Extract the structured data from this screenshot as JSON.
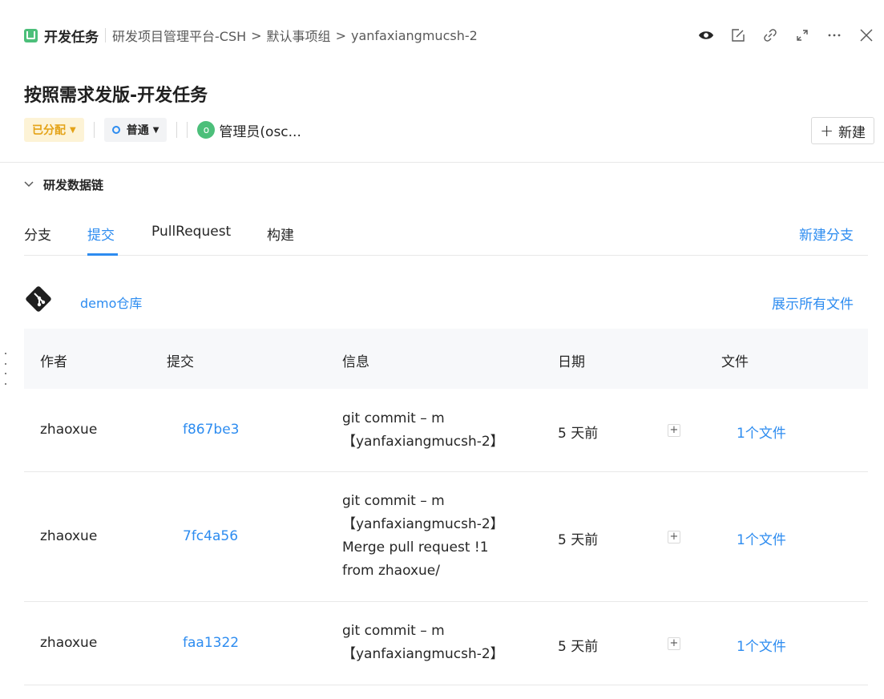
{
  "header": {
    "task_type": "开发任务",
    "breadcrumb": [
      "研发项目管理平台-CSH",
      "默认事项组",
      "yanfaxiangmucsh-2"
    ],
    "breadcrumb_sep": ">"
  },
  "task": {
    "title": "按照需求发版-开发任务",
    "status": "已分配",
    "priority": "普通",
    "assignee_initial": "o",
    "assignee": "管理员(osc...",
    "new_button": "新建"
  },
  "section": {
    "title": "研发数据链",
    "tabs": [
      "分支",
      "提交",
      "PullRequest",
      "构建"
    ],
    "active_tab": "提交",
    "tab_action": "新建分支"
  },
  "repo": {
    "name": "demo仓库",
    "show_all": "展示所有文件"
  },
  "table": {
    "headers": [
      "作者",
      "提交",
      "信息",
      "日期",
      "文件"
    ],
    "rows": [
      {
        "author": "zhaoxue",
        "commit": "f867be3",
        "message": [
          "git commit – m",
          "【yanfaxiangmucsh-2】"
        ],
        "date": "5 天前",
        "files": "1个文件"
      },
      {
        "author": "zhaoxue",
        "commit": "7fc4a56",
        "message": [
          "git commit – m",
          "【yanfaxiangmucsh-2】",
          "Merge pull request !1",
          "from zhaoxue/"
        ],
        "date": "5 天前",
        "files": "1个文件"
      },
      {
        "author": "zhaoxue",
        "commit": "faa1322",
        "message": [
          "git commit – m",
          "【yanfaxiangmucsh-2】"
        ],
        "date": "5 天前",
        "files": "1个文件"
      }
    ]
  },
  "icons": {
    "task_type": "task-icon",
    "watch": "eye-icon",
    "edit": "edit-icon",
    "link": "link-icon",
    "expand": "expand-icon",
    "more": "more-icon",
    "close": "close-icon",
    "repo": "git-icon",
    "collapse": "chevron-down-icon"
  },
  "colors": {
    "accent": "#2d8cf0",
    "status_bg": "#fdf3d6",
    "status_text": "#e4a318",
    "task_green": "#4cbf7a"
  }
}
